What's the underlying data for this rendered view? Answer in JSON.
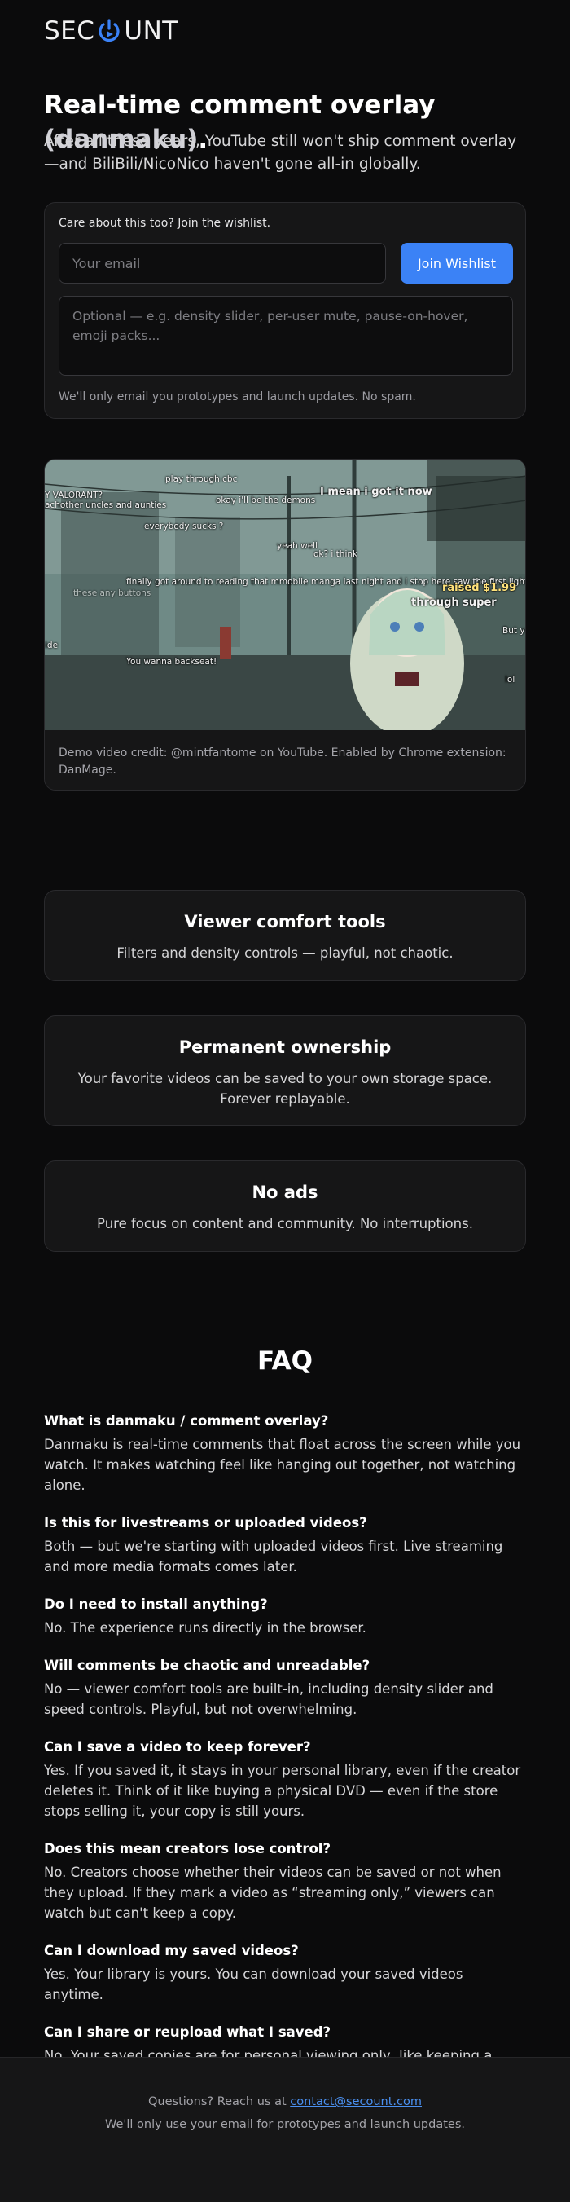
{
  "brand": {
    "name_prefix": "SEC",
    "name_suffix": "UNT"
  },
  "hero": {
    "title_main": "Real-time comment overlay ",
    "title_accent": "(danmaku)",
    "title_end": ".",
    "subtitle": "After all these years, YouTube still won't ship comment overlay—and BiliBili/NicoNico haven't gone all-in globally."
  },
  "wishlist": {
    "label": "Care about this too? Join the wishlist.",
    "email_placeholder": "Your email",
    "email_value": "",
    "button_label": "Join Wishlist",
    "optional_placeholder": "Optional — e.g. density slider, per-user mute, pause-on-hover, emoji packs...",
    "note": "We'll only email you prototypes and launch updates. No spam."
  },
  "video": {
    "credit": "Demo video credit: @mintfantome on YouTube. Enabled by Chrome extension: DanMage.",
    "comments": [
      "play through cbc",
      "Y VALORANT?",
      "achother uncles and aunties",
      "I mean i got it now",
      "okay i'll be the demons",
      "everybody sucks ?",
      "finally got around to reading that mmobile manga last night and i stop here saw the first light",
      "these any buttons",
      "raised $1.99",
      "through super",
      "You wanna backseat!",
      "ide",
      "lol",
      "But yo",
      "yeah well",
      "ok? i think"
    ]
  },
  "features": [
    {
      "title": "Viewer comfort tools",
      "text": "Filters and density controls — playful, not chaotic."
    },
    {
      "title": "Permanent ownership",
      "text": "Your favorite videos can be saved to your own storage space. Forever replayable."
    },
    {
      "title": "No ads",
      "text": "Pure focus on content and community. No interruptions."
    }
  ],
  "faq": {
    "title": "FAQ",
    "items": [
      {
        "q": "What is danmaku / comment overlay?",
        "a": "Danmaku is real-time comments that float across the screen while you watch. It makes watching feel like hanging out together, not watching alone."
      },
      {
        "q": "Is this for livestreams or uploaded videos?",
        "a": "Both — but we're starting with uploaded videos first. Live streaming and more media formats comes later."
      },
      {
        "q": "Do I need to install anything?",
        "a": "No. The experience runs directly in the browser."
      },
      {
        "q": "Will comments be chaotic and unreadable?",
        "a": "No — viewer comfort tools are built-in, including density slider and speed controls. Playful, but not overwhelming."
      },
      {
        "q": "Can I save a video to keep forever?",
        "a": "Yes. If you saved it, it stays in your personal library, even if the creator deletes it. Think of it like buying a physical DVD — even if the store stops selling it, your copy is still yours."
      },
      {
        "q": "Does this mean creators lose control?",
        "a": "No. Creators choose whether their videos can be saved or not when they upload. If they mark a video as “streaming only,” viewers can watch but can't keep a copy."
      },
      {
        "q": "Can I download my saved videos?",
        "a": "Yes. Your library is yours. You can download your saved videos anytime."
      },
      {
        "q": "Can I share or reupload what I saved?",
        "a": "No. Your saved copies are for personal viewing only, like keeping a book or DVD. You own your copy to watch, not to redistribute."
      }
    ]
  },
  "footer": {
    "questions_prefix": "Questions? Reach us at ",
    "email": "contact@secount.com",
    "note": "We'll only use your email for prototypes and launch updates."
  },
  "colors": {
    "accent": "#3b82f6",
    "background": "#0b0b0c",
    "card": "#161617",
    "link": "#4a90f0"
  }
}
